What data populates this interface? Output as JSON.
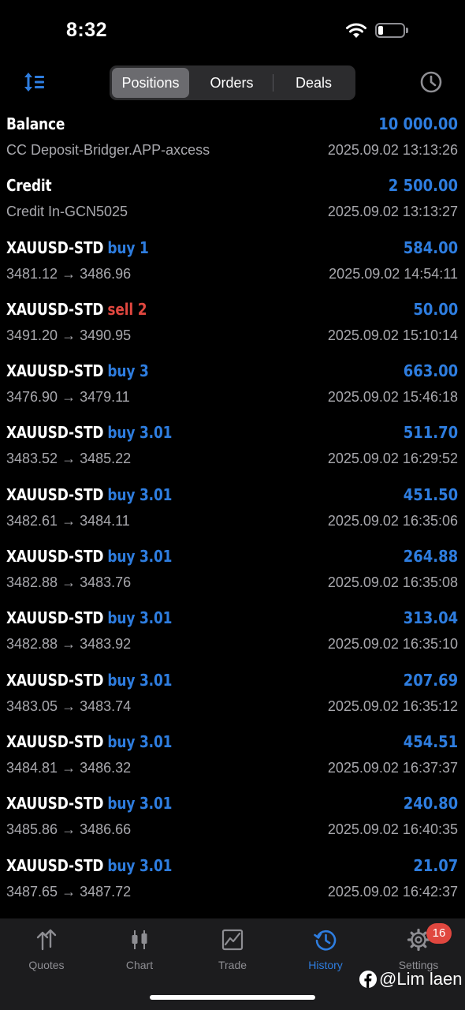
{
  "status_bar": {
    "time": "8:32",
    "battery_percent": 20
  },
  "segments": [
    {
      "label": "Positions",
      "active": true
    },
    {
      "label": "Orders",
      "active": false
    },
    {
      "label": "Deals",
      "active": false
    }
  ],
  "rows": [
    {
      "symbol": "Balance",
      "side": "",
      "side_type": "",
      "amount": "10 000.00",
      "sub": "CC Deposit-Bridger.APP-axcess",
      "time": "2025.09.02 13:13:26"
    },
    {
      "symbol": "Credit",
      "side": "",
      "side_type": "",
      "amount": "2 500.00",
      "sub": "Credit In-GCN5025",
      "time": "2025.09.02 13:13:27"
    },
    {
      "symbol": "XAUUSD-STD",
      "side": "buy 1",
      "side_type": "buy",
      "amount": "584.00",
      "sub": "3481.12 → 3486.96",
      "time": "2025.09.02 14:54:11"
    },
    {
      "symbol": "XAUUSD-STD",
      "side": "sell 2",
      "side_type": "sell",
      "amount": "50.00",
      "sub": "3491.20 → 3490.95",
      "time": "2025.09.02 15:10:14"
    },
    {
      "symbol": "XAUUSD-STD",
      "side": "buy 3",
      "side_type": "buy",
      "amount": "663.00",
      "sub": "3476.90 → 3479.11",
      "time": "2025.09.02 15:46:18"
    },
    {
      "symbol": "XAUUSD-STD",
      "side": "buy 3.01",
      "side_type": "buy",
      "amount": "511.70",
      "sub": "3483.52 → 3485.22",
      "time": "2025.09.02 16:29:52"
    },
    {
      "symbol": "XAUUSD-STD",
      "side": "buy 3.01",
      "side_type": "buy",
      "amount": "451.50",
      "sub": "3482.61 → 3484.11",
      "time": "2025.09.02 16:35:06"
    },
    {
      "symbol": "XAUUSD-STD",
      "side": "buy 3.01",
      "side_type": "buy",
      "amount": "264.88",
      "sub": "3482.88 → 3483.76",
      "time": "2025.09.02 16:35:08"
    },
    {
      "symbol": "XAUUSD-STD",
      "side": "buy 3.01",
      "side_type": "buy",
      "amount": "313.04",
      "sub": "3482.88 → 3483.92",
      "time": "2025.09.02 16:35:10"
    },
    {
      "symbol": "XAUUSD-STD",
      "side": "buy 3.01",
      "side_type": "buy",
      "amount": "207.69",
      "sub": "3483.05 → 3483.74",
      "time": "2025.09.02 16:35:12"
    },
    {
      "symbol": "XAUUSD-STD",
      "side": "buy 3.01",
      "side_type": "buy",
      "amount": "454.51",
      "sub": "3484.81 → 3486.32",
      "time": "2025.09.02 16:37:37"
    },
    {
      "symbol": "XAUUSD-STD",
      "side": "buy 3.01",
      "side_type": "buy",
      "amount": "240.80",
      "sub": "3485.86 → 3486.66",
      "time": "2025.09.02 16:40:35"
    },
    {
      "symbol": "XAUUSD-STD",
      "side": "buy 3.01",
      "side_type": "buy",
      "amount": "21.07",
      "sub": "3487.65 → 3487.72",
      "time": "2025.09.02 16:42:37"
    }
  ],
  "tabs": [
    {
      "label": "Quotes",
      "icon": "quotes-icon",
      "active": false
    },
    {
      "label": "Chart",
      "icon": "chart-icon",
      "active": false
    },
    {
      "label": "Trade",
      "icon": "trade-icon",
      "active": false
    },
    {
      "label": "History",
      "icon": "history-icon",
      "active": true
    },
    {
      "label": "Settings",
      "icon": "settings-icon",
      "active": false
    }
  ],
  "settings_badge": "16",
  "watermark": "@Lim laen",
  "colors": {
    "accent": "#2e7ddf",
    "sell": "#e0473f",
    "background": "#000000",
    "secondary_text": "#a8a8ad"
  }
}
